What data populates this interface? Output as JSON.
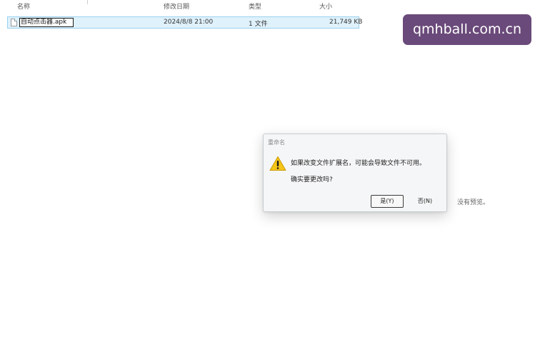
{
  "columns": {
    "name": "名称",
    "modified": "修改日期",
    "type": "类型",
    "size": "大小"
  },
  "file": {
    "name": "自动点击器.apk",
    "modified": "2024/8/8 21:00",
    "type": "1 文件",
    "size": "21,749 KB"
  },
  "watermark": "qmhball.com.cn",
  "preview_pane": {
    "text": "没有预览。"
  },
  "dialog": {
    "title": "重命名",
    "message": "如果改变文件扩展名，可能会导致文件不可用。",
    "question": "确实要更改吗?",
    "yes_label": "是(Y)",
    "no_label": "否(N)",
    "icon": "warning-icon"
  },
  "colors": {
    "selection_bg": "#dff1fb",
    "selection_border": "#99d1ef",
    "watermark_bg": "#6a4a7a",
    "warning_yellow": "#f5c518"
  }
}
